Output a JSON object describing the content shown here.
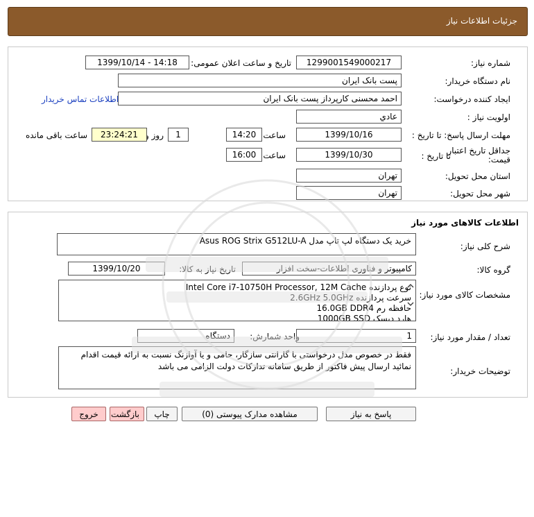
{
  "header": {
    "title": "جزئیات اطلاعات نیاز"
  },
  "info": {
    "need_number_label": "شماره نیاز:",
    "need_number": "1299001549000217",
    "announce_label": "تاریخ و ساعت اعلان عمومی:",
    "announce_value": "1399/10/14 - 14:18",
    "buyer_label": "نام دستگاه خریدار:",
    "buyer": "پست بانک ایران",
    "requester_label": "ایجاد کننده درخواست:",
    "requester": "احمد  محسنی کارپرداز پست بانک ایران",
    "contact_link": "اطلاعات تماس خریدار",
    "priority_label": "اولویت نیاز :",
    "priority": "عادي",
    "deadline_label": "مهلت ارسال پاسخ: تا تاریخ :",
    "deadline_date": "1399/10/16",
    "time_label": "ساعت",
    "deadline_time": "14:20",
    "days_value": "1",
    "days_label": "روز و",
    "remaining_time": "23:24:21",
    "remaining_label": "ساعت باقی مانده",
    "validity_label_1": "جداقل تاریخ اعتبار",
    "validity_label_2": "قیمت:",
    "validity_to_label": "تا تاریخ :",
    "validity_date": "1399/10/30",
    "validity_time": "16:00",
    "province_label": "استان محل تحویل:",
    "province": "تهران",
    "city_label": "شهر محل تحویل:",
    "city": "تهران"
  },
  "goods": {
    "section_title": "اطلاعات کالاهای مورد نیاز",
    "general_desc_label": "شرح کلی نیاز:",
    "general_desc": "خرید یک دستگاه لپ تاپ مدل Asus ROG Strix G512LU-A",
    "group_label": "گروه کالا:",
    "group": "کامپیوتر و فناوری اطلاعات-سخت افزار",
    "need_date_label": "تاریخ نیاز به کالا:",
    "need_date": "1399/10/20",
    "specs_label": "مشخصات کالای مورد نیاز:",
    "specs": [
      "نوع پردازنده Intel Core i7-10750H Processor, 12M Cache",
      "سرعت پردازنده 2.6GHz 5.0GHz",
      "حافظه رم 16.0GB DDR4",
      "هارد دیسک 1000GB SSD"
    ],
    "qty_label": "تعداد / مقدار مورد نیاز:",
    "qty": "1",
    "unit_label": "واحد شمارش:",
    "unit": "دستگاه",
    "buyer_notes_label": "توضیحات خریدار:",
    "buyer_notes": "فقط در خصوص مدل درخواستی با گارانتی سازگار، حامی و یا آوازنگ نسبت به ارائه قیمت اقدام نمائید ارسال پیش فاکتور از طریق سامانه تداركات دولت الزامی می باشد"
  },
  "buttons": {
    "reply": "پاسخ به نیاز",
    "attachments": "مشاهده مدارک پیوستی (0)",
    "print": "چاپ",
    "back": "بازگشت",
    "exit": "خروج"
  },
  "colors": {
    "header_bg": "#8b5a2b",
    "remaining_bg": "#ffffcc",
    "exit_bg": "#ffcccc",
    "link": "#1a3fbf"
  }
}
